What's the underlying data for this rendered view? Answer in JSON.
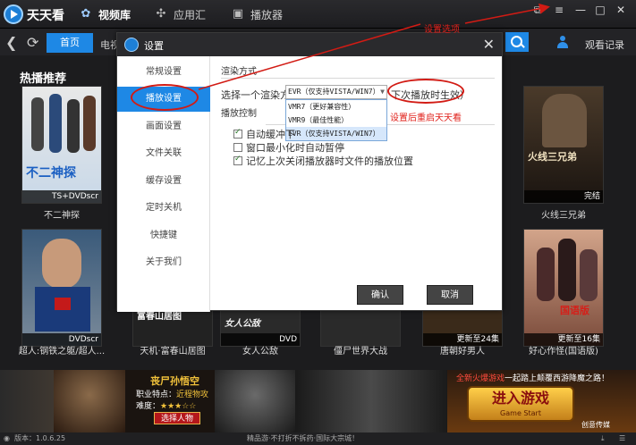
{
  "app": {
    "title": "天天看",
    "nav": [
      "视频库",
      "应用汇",
      "播放器"
    ]
  },
  "toolbar": {
    "home_tab": "首页",
    "next_tab_partial": "电视",
    "watch_record": "观看记录"
  },
  "section": {
    "hot_title": "热播推荐"
  },
  "posters": [
    {
      "caption": "不二神探",
      "ribbon": "TS+DVDscr",
      "art_text": "不二神探"
    },
    {
      "caption": "超人:钢铁之躯/超人...",
      "ribbon": "DVDscr",
      "art_text": ""
    },
    {
      "caption": "天机·富春山居图",
      "ribbon": "",
      "art_text": "富春山居图"
    },
    {
      "caption": "女人公敌",
      "ribbon": "DVD",
      "art_text": "女人公敌"
    },
    {
      "caption": "僵尸世界大战",
      "ribbon": "",
      "art_text": ""
    },
    {
      "caption": "唐朝好男人",
      "ribbon": "更新至24集",
      "art_text": ""
    },
    {
      "caption": "火线三兄弟",
      "ribbon": "完结",
      "art_text": "火线三兄弟"
    },
    {
      "caption": "好心作怪(国语版)",
      "ribbon": "更新至16集",
      "art_text": "国语版"
    }
  ],
  "dialog": {
    "title": "设置",
    "sidebar": [
      "常规设置",
      "播放设置",
      "画面设置",
      "文件关联",
      "缓存设置",
      "定时关机",
      "快捷键",
      "关于我们"
    ],
    "active_index": 1,
    "render_section": "渲染方式",
    "render_label": "选择一个渲染方式",
    "render_selected": "EVR（仅支持VISTA/WIN7）",
    "render_note": "下次播放时生效）",
    "render_options": [
      "VMR7（更好兼容性）",
      "VMR9（最佳性能）",
      "EVR（仅支持VISTA/WIN7）"
    ],
    "playback_section": "播放控制",
    "checkboxes": [
      {
        "label": "自动缓冲下",
        "checked": true
      },
      {
        "label": "窗口最小化时自动暂停",
        "checked": false
      },
      {
        "label": "记忆上次关闭播放器时文件的播放位置",
        "checked": true
      }
    ],
    "ok_label": "确认",
    "cancel_label": "取消"
  },
  "annotations": {
    "settings_option": "设置选项",
    "restart_note": "设置后重启天天看"
  },
  "banner": {
    "zombie_title": "丧尸孙悟空",
    "zombie_trait_prefix": "职业特点：",
    "zombie_trait": "近程物攻",
    "zombie_diff_prefix": "难度：",
    "zombie_stars": "★★★☆☆",
    "select_button": "选择人物",
    "top_text": "全新火爆游戏",
    "top_text_rest": "一起踏上颠覆西游降魔之路！",
    "game_button": "进入游戏",
    "game_button_sub": "Game Start",
    "corner_tag": "创意传媒"
  },
  "status": {
    "version": "版本：1.0.6.25",
    "ticker": "精品游·不打折不拆药·国际大宗城！"
  },
  "colors": {
    "accent": "#1e88e5",
    "annotation_red": "#e0201a",
    "background": "#1c1c1e"
  }
}
